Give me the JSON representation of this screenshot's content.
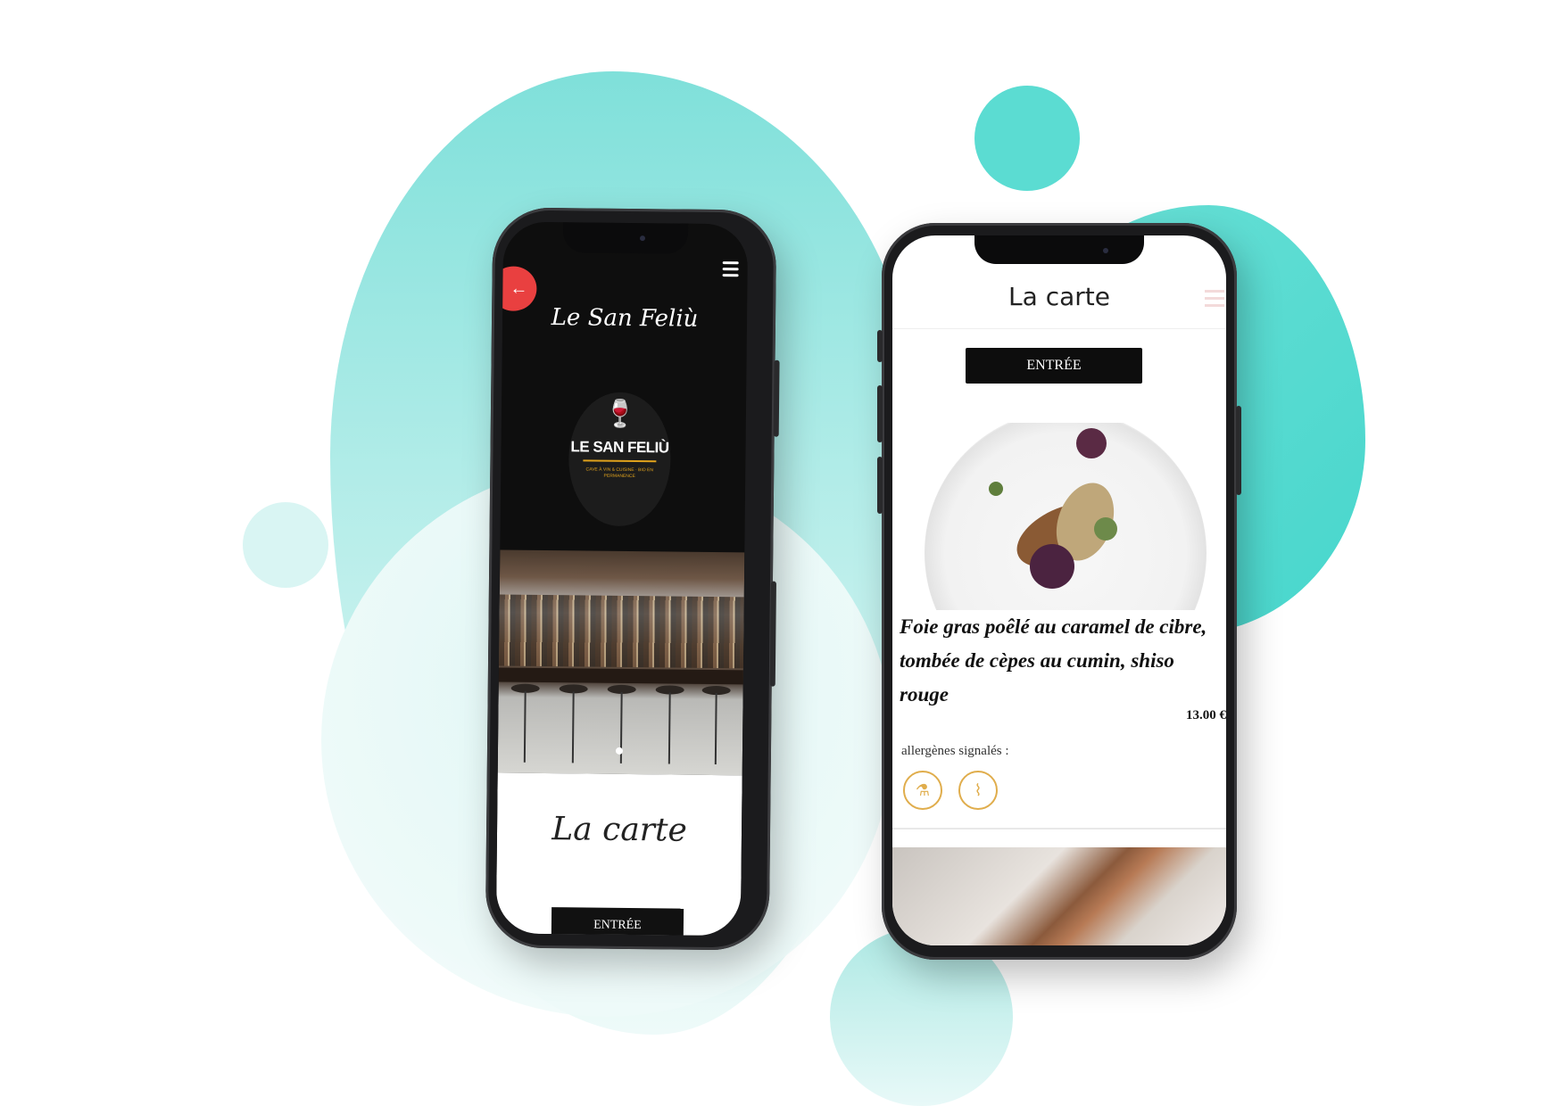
{
  "left_phone": {
    "restaurant_name": "Le San Feliù",
    "logo": {
      "name": "LE SAN FELIÙ",
      "tagline": "CAVE À VIN & CUISINE · BIO EN PERMANENCE"
    },
    "section_title": "La carte",
    "category_button": "ENTRÉE",
    "icons": {
      "back": "arrow-left-icon",
      "menu": "hamburger-icon"
    }
  },
  "right_phone": {
    "header_title": "La carte",
    "category_button": "ENTRÉE",
    "dish": {
      "name": "Foie gras poêlé au caramel de cibre, tombée de cèpes au cumin, shiso rouge",
      "price": "13.00 €",
      "allergens_label": "allergènes signalés :",
      "allergen_icons": [
        "sulphites-icon",
        "celery-icon"
      ]
    }
  },
  "colors": {
    "accent_gold": "#e0a21c",
    "back_button": "#e94040",
    "teal_blob": "#5bdcd2"
  }
}
